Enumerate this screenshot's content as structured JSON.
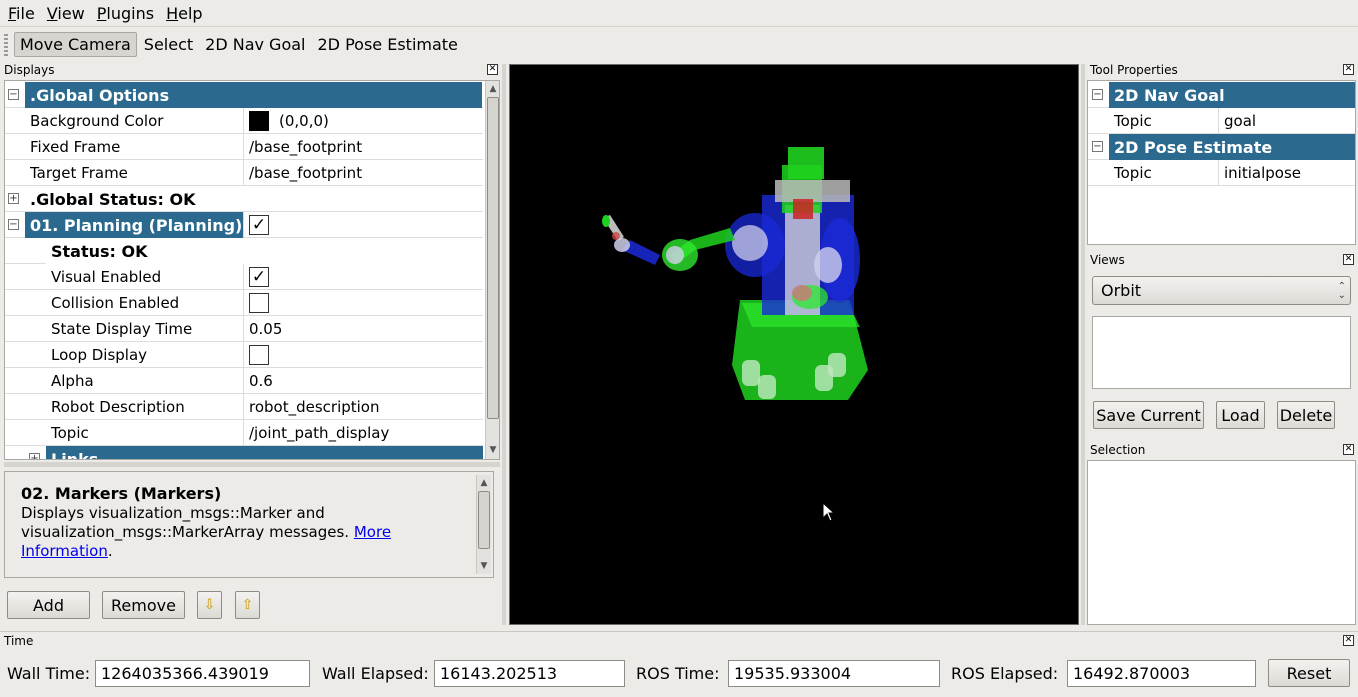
{
  "menu": [
    {
      "label_u": "F",
      "label_rest": "ile"
    },
    {
      "label_u": "V",
      "label_rest": "iew"
    },
    {
      "label_u": "P",
      "label_rest": "lugins"
    },
    {
      "label_u": "H",
      "label_rest": "elp"
    }
  ],
  "toolbar": {
    "tools": [
      "Move Camera",
      "Select",
      "2D Nav Goal",
      "2D Pose Estimate"
    ],
    "active": "Move Camera"
  },
  "displays": {
    "title": "Displays",
    "global_options": ".Global Options",
    "bg_color_label": "Background Color",
    "bg_color_value": "(0,0,0)",
    "fixed_frame_label": "Fixed Frame",
    "fixed_frame_value": "/base_footprint",
    "target_frame_label": "Target Frame",
    "target_frame_value": "/base_footprint",
    "global_status": ".Global Status: OK",
    "planning": "01. Planning (Planning)",
    "status": "Status: OK",
    "visual_enabled_label": "Visual Enabled",
    "collision_enabled_label": "Collision Enabled",
    "state_display_time_label": "State Display Time",
    "state_display_time_value": "0.05",
    "loop_display_label": "Loop Display",
    "alpha_label": "Alpha",
    "alpha_value": "0.6",
    "robot_description_label": "Robot Description",
    "robot_description_value": "robot_description",
    "topic_label": "Topic",
    "topic_value": "/joint_path_display",
    "links": "Links"
  },
  "description": {
    "title": "02. Markers (Markers)",
    "text": "Displays visualization_msgs::Marker and visualization_msgs::MarkerArray messages.",
    "link": "More Information",
    "after_link": "."
  },
  "buttons": {
    "add": "Add",
    "remove": "Remove",
    "down_arrow": "⇩",
    "up_arrow": "⇧"
  },
  "tool_properties": {
    "title": "Tool Properties",
    "nav_goal": "2D Nav Goal",
    "nav_goal_topic_label": "Topic",
    "nav_goal_topic_value": "goal",
    "pose_estimate": "2D Pose Estimate",
    "pose_topic_label": "Topic",
    "pose_topic_value": "initialpose"
  },
  "views": {
    "title": "Views",
    "selected": "Orbit",
    "save_current": "Save Current",
    "load": "Load",
    "delete": "Delete"
  },
  "selection": {
    "title": "Selection"
  },
  "time": {
    "title": "Time",
    "wall_time_label": "Wall Time:",
    "wall_time_value": "1264035366.439019",
    "wall_elapsed_label": "Wall Elapsed:",
    "wall_elapsed_value": "16143.202513",
    "ros_time_label": "ROS Time:",
    "ros_time_value": "19535.933004",
    "ros_elapsed_label": "ROS Elapsed:",
    "ros_elapsed_value": "16492.870003",
    "reset": "Reset"
  },
  "colors": {
    "category_bg": "#2b6a8e",
    "robot_green": "#1fd21f",
    "robot_blue": "#1a2ad8"
  }
}
